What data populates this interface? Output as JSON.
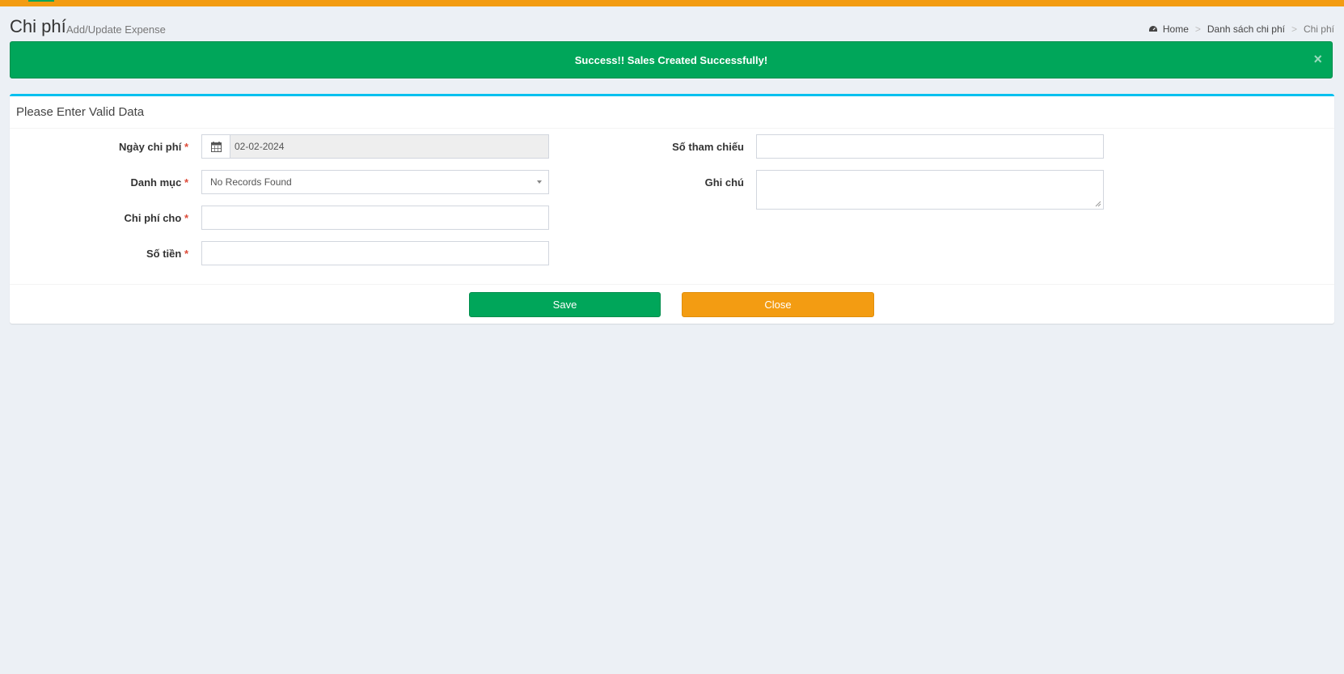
{
  "header": {
    "title": "Chi phí",
    "subtitle": "Add/Update Expense"
  },
  "breadcrumb": {
    "home": "Home",
    "list": "Danh sách chi phí",
    "current": "Chi phí",
    "separator": ">"
  },
  "alert": {
    "message": "Success!! Sales Created Successfully!",
    "close": "×"
  },
  "form": {
    "box_title": "Please Enter Valid Data",
    "required_mark": "*",
    "expense_date": {
      "label": "Ngày chi phí",
      "value": "02-02-2024"
    },
    "category": {
      "label": "Danh mục",
      "value": "No Records Found"
    },
    "expense_for": {
      "label": "Chi phí cho",
      "value": ""
    },
    "amount": {
      "label": "Số tiền",
      "value": ""
    },
    "reference_no": {
      "label": "Số tham chiếu",
      "value": ""
    },
    "note": {
      "label": "Ghi chú",
      "value": ""
    },
    "save_label": "Save",
    "close_label": "Close"
  },
  "colors": {
    "topbar": "#f39c12",
    "success": "#00a65a",
    "warning": "#f39c12",
    "box_border": "#00c0ef",
    "required": "#dd4b39"
  },
  "icons": {
    "breadcrumb_home": "dashboard-icon",
    "date_addon": "calendar-icon",
    "select_arrow": "caret-down-icon",
    "alert_close": "close-icon"
  }
}
